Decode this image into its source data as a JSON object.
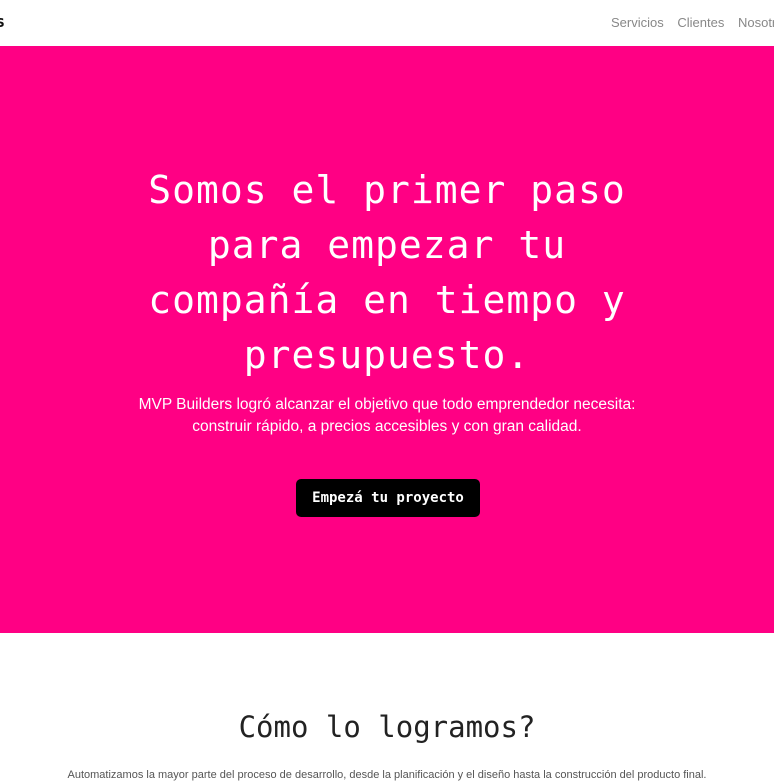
{
  "navbar": {
    "brand": "S",
    "links": [
      "Servicios",
      "Clientes",
      "Nosotros"
    ]
  },
  "hero": {
    "title_lines": [
      "Somos el primer paso",
      "para empezar tu",
      "compañía en tiempo y",
      "presupuesto."
    ],
    "subtitle_lines": [
      "MVP Builders logró alcanzar el objetivo que todo emprendedor necesita:",
      "construir rápido, a precios accesibles y con gran calidad."
    ],
    "cta_label": "Empezá tu proyecto"
  },
  "how": {
    "title": "Cómo lo logramos?",
    "text": "Automatizamos la mayor parte del proceso de desarrollo, desde la planificación y el diseño hasta la construcción del producto final."
  },
  "colors": {
    "hero_bg": "#ff0084",
    "cta_bg": "#000000",
    "nav_link": "#888888"
  }
}
